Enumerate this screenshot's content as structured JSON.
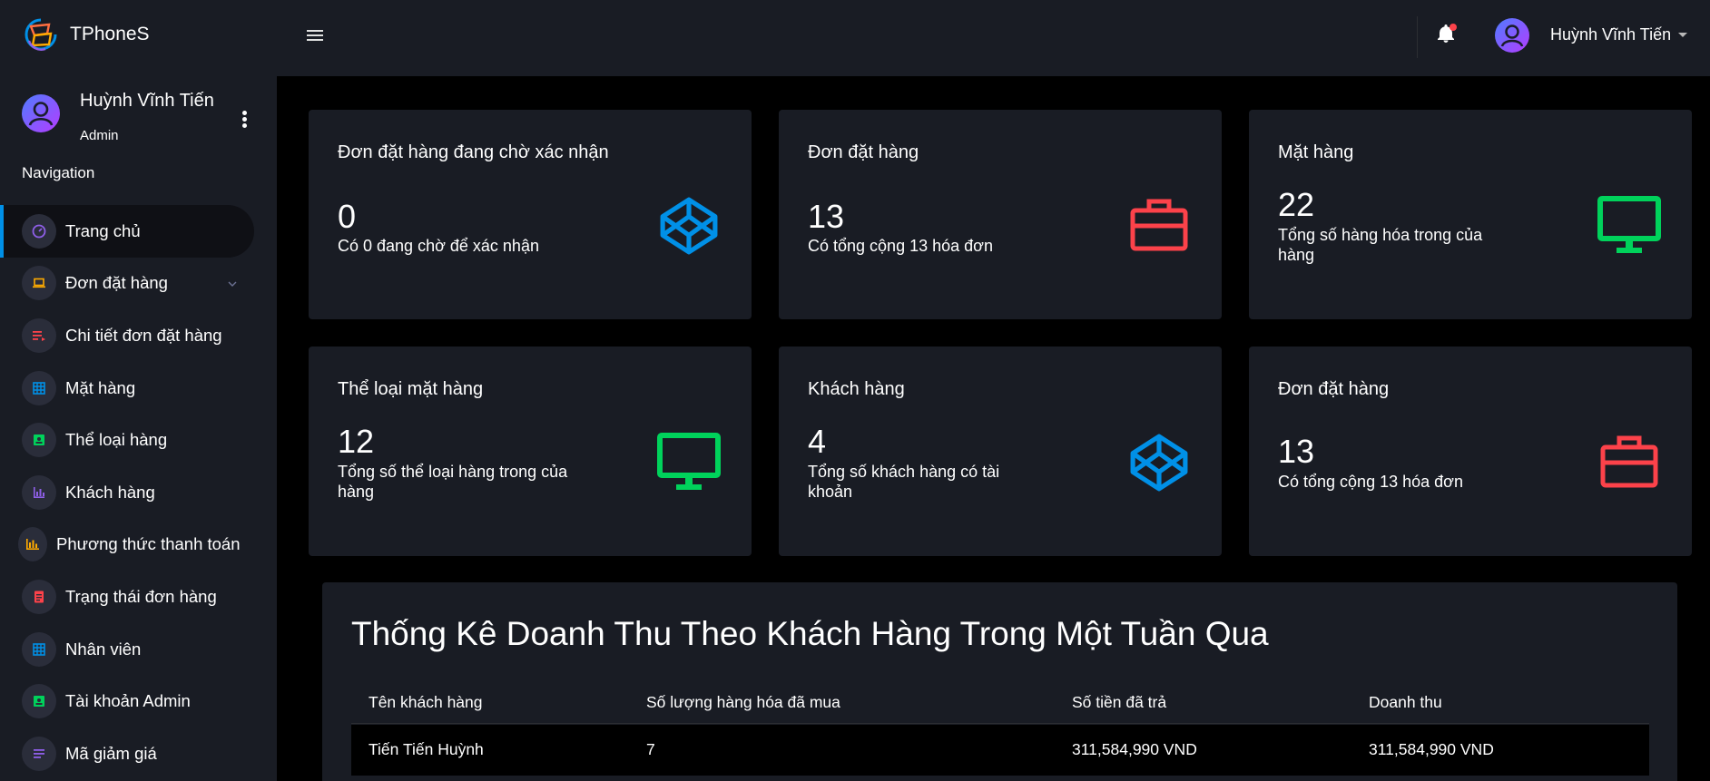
{
  "brand": {
    "name": "TPhoneS",
    "logo": "tphones-logo"
  },
  "topbar": {
    "menu_icon": "hamburger-icon",
    "notification_icon": "bell-icon",
    "user_name": "Huỳnh Vĩnh Tiến"
  },
  "sidebar": {
    "profile": {
      "name": "Huỳnh Vĩnh Tiến",
      "role": "Admin"
    },
    "nav_heading": "Navigation",
    "items": [
      {
        "label": "Trang chủ",
        "icon": "speedometer-icon",
        "color": "#8f5fe8",
        "active": true
      },
      {
        "label": "Đơn đặt hàng",
        "icon": "laptop-icon",
        "color": "#ffab00",
        "has_submenu": true
      },
      {
        "label": "Chi tiết đơn đặt hàng",
        "icon": "playlist-icon",
        "color": "#fc424a"
      },
      {
        "label": "Mặt hàng",
        "icon": "grid-icon",
        "color": "#0090e7"
      },
      {
        "label": "Thể loại hàng",
        "icon": "contacts-icon",
        "color": "#00d25b"
      },
      {
        "label": "Khách hàng",
        "icon": "bar-chart-icon",
        "color": "#8f5fe8"
      },
      {
        "label": "Phương thức thanh toán",
        "icon": "chart-bar-icon",
        "color": "#ffab00"
      },
      {
        "label": "Trạng thái đơn hàng",
        "icon": "document-icon",
        "color": "#fc424a"
      },
      {
        "label": "Nhân viên",
        "icon": "grid-icon",
        "color": "#0090e7"
      },
      {
        "label": "Tài khoản Admin",
        "icon": "contacts-icon",
        "color": "#00d25b"
      },
      {
        "label": "Mã giảm giá",
        "icon": "list-icon",
        "color": "#8f5fe8"
      }
    ]
  },
  "cards": [
    {
      "title": "Đơn đặt hàng đang chờ xác nhận",
      "value": "0",
      "desc": "Có 0 đang chờ để xác nhận",
      "icon": "codepen-icon",
      "color": "#0090e7"
    },
    {
      "title": "Đơn đặt hàng",
      "value": "13",
      "desc": "Có tổng cộng 13 hóa đơn",
      "icon": "briefcase-icon",
      "color": "#fc424a"
    },
    {
      "title": "Mặt hàng",
      "value": "22",
      "desc": "Tổng số hàng hóa trong của hàng",
      "icon": "monitor-icon",
      "color": "#00d25b"
    },
    {
      "title": "Thể loại mặt hàng",
      "value": "12",
      "desc": "Tổng số thể loại hàng trong của hàng",
      "icon": "monitor-icon",
      "color": "#00d25b"
    },
    {
      "title": "Khách hàng",
      "value": "4",
      "desc": "Tổng số khách hàng có tài khoản",
      "icon": "codepen-icon",
      "color": "#0090e7"
    },
    {
      "title": "Đơn đặt hàng",
      "value": "13",
      "desc": "Có tổng cộng 13 hóa đơn",
      "icon": "briefcase-icon",
      "color": "#fc424a"
    }
  ],
  "revenue": {
    "title": "Thống Kê Doanh Thu Theo Khách Hàng Trong Một Tuần Qua",
    "columns": [
      "Tên khách hàng",
      "Số lượng hàng hóa đã mua",
      "Số tiền đã trả",
      "Doanh thu"
    ],
    "rows": [
      [
        "Tiến Tiến Huỳnh",
        "7",
        "311,584,990 VND",
        "311,584,990 VND"
      ]
    ]
  }
}
